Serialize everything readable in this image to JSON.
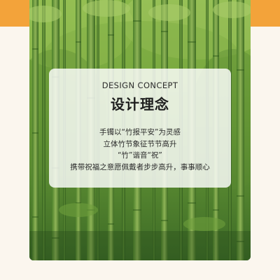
{
  "design_concept": {
    "title_en": "DESIGN CONCEPT",
    "title_cn": "设计理念",
    "lines": [
      "手镯以“竹报平安”为灵感",
      "立体竹节象征节节高升",
      "“竹”谐音“祝”",
      "携带祝福之意愿佩戴者步步高升，事事顺心"
    ]
  },
  "colors": {
    "accent_orange": "#f3a33a",
    "page_background": "#fbf6ee",
    "bamboo_green": "#5a8f2f"
  }
}
